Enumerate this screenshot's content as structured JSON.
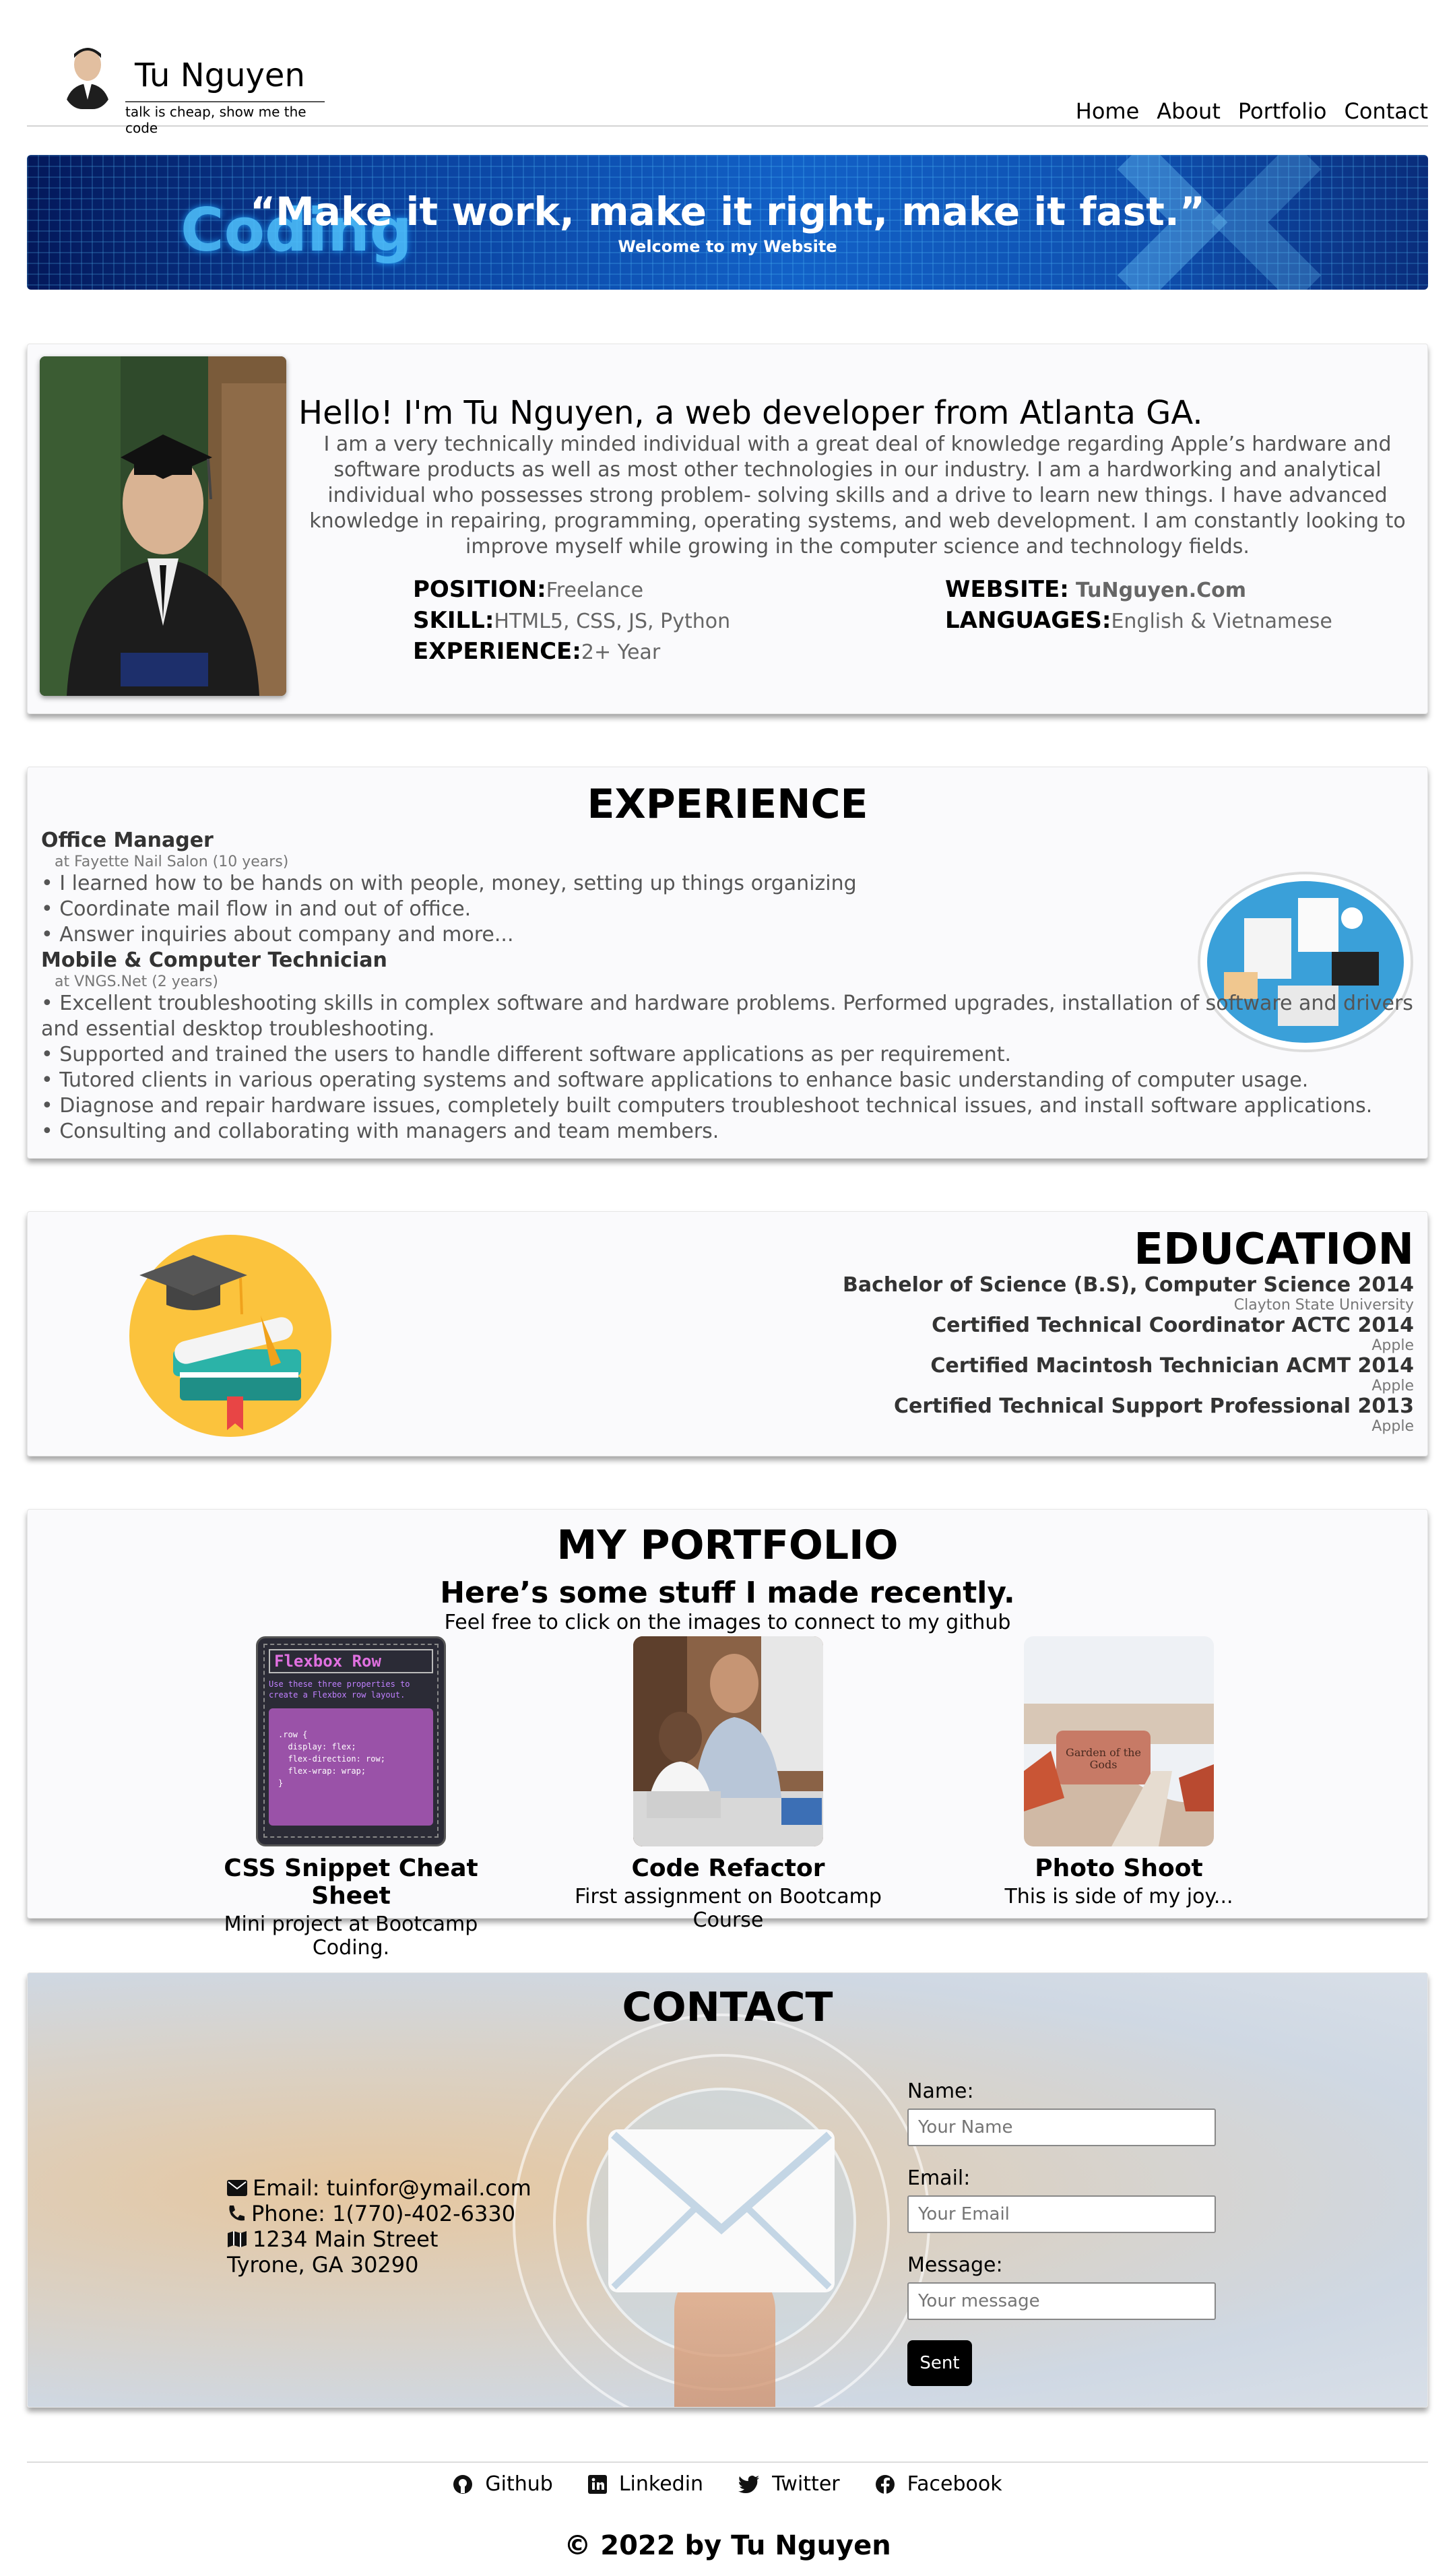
{
  "header": {
    "site_name": "Tu Nguyen",
    "tagline": "talk is cheap, show me the code",
    "nav": [
      "Home",
      "About",
      "Portfolio",
      "Contact"
    ]
  },
  "hero": {
    "bg_word": "Coding",
    "quote": "“Make it work, make it right, make it fast.”",
    "subtitle": "Welcome to my Website"
  },
  "about": {
    "heading": "Hello! I'm Tu Nguyen, a web developer from Atlanta GA.",
    "bio": "I am a very technically minded individual with a great deal of knowledge regarding Apple’s hardware and software products as well as most other technologies in our industry. I am a hardworking and analytical individual who possesses strong problem- solving skills and a drive to learn new things. I have advanced knowledge in repairing, programming, operating systems, and web development. I am constantly looking to improve myself while growing in the computer science and technology fields.",
    "position_label": "POSITION:",
    "position": "Freelance",
    "skill_label": "SKILL:",
    "skill": "HTML5, CSS, JS, Python",
    "experience_label": "EXPERIENCE:",
    "experience": "2+ Year",
    "website_label": "WEBSITE:",
    "website": "TuNguyen.Com",
    "languages_label": "LANGUAGES:",
    "languages": "English & Vietnamese"
  },
  "experience": {
    "title": "EXPERIENCE",
    "jobs": [
      {
        "title": "Office Manager",
        "at": "at Fayette Nail Salon (10 years)",
        "bullets": [
          "• I learned how to be hands on with people, money, setting up things organizing",
          "• Coordinate mail flow in and out of office.",
          "• Answer inquiries about company and more..."
        ]
      },
      {
        "title": "Mobile & Computer Technician",
        "at": "at VNGS.Net (2 years)",
        "bullets": [
          "• Excellent troubleshooting skills in complex software and hardware problems. Performed upgrades, installation of software and drivers and essential desktop troubleshooting.",
          "• Supported and trained the users to handle different software applications as per requirement.",
          "• Tutored clients in various operating systems and software applications to enhance basic understanding of computer usage.",
          "• Diagnose and repair hardware issues, completely built computers troubleshoot technical issues, and install software applications.",
          "• Consulting and collaborating with managers and team members."
        ]
      }
    ]
  },
  "education": {
    "title": "EDUCATION",
    "items": [
      {
        "degree": "Bachelor of Science (B.S), Computer Science 2014",
        "inst": "Clayton State University"
      },
      {
        "degree": "Certified Technical Coordinator ACTC 2014",
        "inst": "Apple"
      },
      {
        "degree": "Certified Macintosh Technician ACMT 2014",
        "inst": "Apple"
      },
      {
        "degree": "Certified Technical Support Professional 2013",
        "inst": "Apple"
      }
    ]
  },
  "portfolio": {
    "title": "MY PORTFOLIO",
    "subtitle": "Here’s some stuff I made recently.",
    "lead": "Feel free to click on the images to connect to my github",
    "items": [
      {
        "title": "CSS Snippet Cheat Sheet",
        "desc": "Mini project at Bootcamp Coding.",
        "thumb_title": "Flexbox Row",
        "thumb_text": "Use these three properties to create a Flexbox row layout.",
        "code": [
          ".row {",
          "  display: flex;",
          "  flex-direction: row;",
          "  flex-wrap: wrap;",
          "}"
        ]
      },
      {
        "title": "Code Refactor",
        "desc": "First assignment on Bootcamp Course"
      },
      {
        "title": "Photo Shoot",
        "desc": "This is side of my joy...",
        "sign_text": "Garden of the Gods"
      }
    ]
  },
  "contact": {
    "title": "CONTACT",
    "email": "Email: tuinfor@ymail.com",
    "phone": "Phone: 1(770)-402-6330",
    "street": "1234 Main Street",
    "city": "Tyrone, GA 30290",
    "name_label": "Name:",
    "name_placeholder": "Your Name",
    "email_label": "Email:",
    "email_placeholder": "Your Email",
    "message_label": "Message:",
    "message_placeholder": "Your message",
    "send_label": "Sent"
  },
  "footer": {
    "social": [
      "Github",
      "Linkedin",
      "Twitter",
      "Facebook"
    ],
    "copyright": "© 2022 by Tu Nguyen"
  }
}
